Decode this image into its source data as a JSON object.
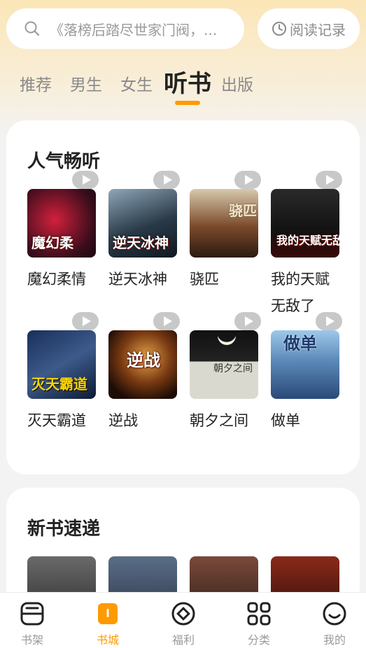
{
  "search": {
    "placeholder": "《落榜后踏尽世家门阀，..."
  },
  "history": {
    "label": "阅读记录",
    "icon": "clock-icon"
  },
  "tabs": [
    {
      "label": "推荐",
      "active": false
    },
    {
      "label": "男生",
      "active": false
    },
    {
      "label": "女生",
      "active": false
    },
    {
      "label": "听书",
      "active": true
    },
    {
      "label": "出版",
      "active": false
    }
  ],
  "section_popular": {
    "title": "人气畅听",
    "books": [
      {
        "title": "魔幻柔情",
        "cover_text": "魔幻柔"
      },
      {
        "title": "逆天冰神",
        "cover_text": "逆天冰神"
      },
      {
        "title": "骁匹",
        "cover_text": "骁匹"
      },
      {
        "title": "我的天赋无敌了",
        "cover_text": "我的天赋无敌"
      },
      {
        "title": "灭天霸道",
        "cover_text": "灭天霸道"
      },
      {
        "title": "逆战",
        "cover_text": "逆战"
      },
      {
        "title": "朝夕之间",
        "cover_text": "朝夕之间"
      },
      {
        "title": "做单",
        "cover_text": "做单"
      }
    ]
  },
  "section_new": {
    "title": "新书速递"
  },
  "nav": [
    {
      "label": "书架",
      "icon": "bookshelf-icon",
      "active": false
    },
    {
      "label": "书城",
      "icon": "bookstore-icon",
      "active": true
    },
    {
      "label": "福利",
      "icon": "welfare-icon",
      "active": false
    },
    {
      "label": "分类",
      "icon": "category-icon",
      "active": false
    },
    {
      "label": "我的",
      "icon": "profile-icon",
      "active": false
    }
  ],
  "colors": {
    "accent": "#ff9a00",
    "top_gradient": "#fbe6b7",
    "text": "#222222",
    "muted": "#9a9a9a"
  }
}
